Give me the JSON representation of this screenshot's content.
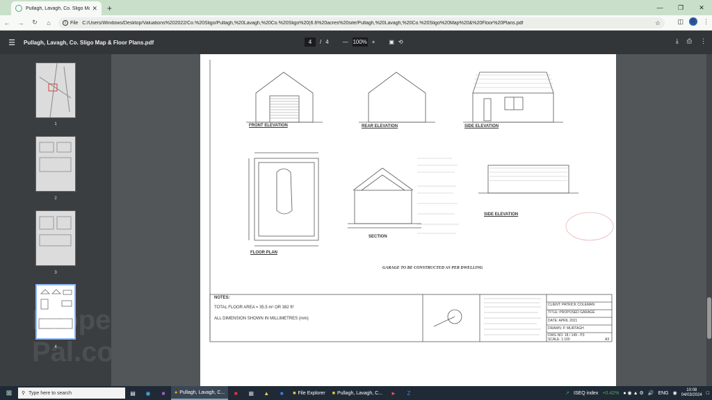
{
  "browser": {
    "tab_title": "Pullagh, Lavagh, Co. Sligo Map",
    "tab_close": "✕",
    "new_tab": "+",
    "window_controls": [
      "—",
      "❐",
      "✕"
    ],
    "address_scheme": "File",
    "address_url": "C:/Users/Windows/Desktop/Valuations%202022/Co.%20Sligo/Pullagh,%20Lavagh,%20Co.%20Sligo%20(6.6%20acres%20site/Pullagh,%20Lavagh,%20Co.%20Sligo%20Map%20&%20Floor%20Plans.pdf",
    "profile_initial": "R"
  },
  "pdf": {
    "document_title": "Pullagh, Lavagh, Co. Sligo Map & Floor Plans.pdf",
    "current_page": "4",
    "page_separator": "/",
    "total_pages": "4",
    "zoom": "100%",
    "thumbnails": [
      {
        "number": "1"
      },
      {
        "number": "2"
      },
      {
        "number": "3"
      },
      {
        "number": "4"
      }
    ],
    "selected_page": 4
  },
  "watermark": {
    "line1": "Property",
    "line2": "Pal.com"
  },
  "drawing": {
    "front_elevation": "FRONT ELEVATION",
    "rear_elevation": "REAR ELEVATION",
    "side_elevation_top": "SIDE ELEVATION",
    "side_elevation_bottom": "SIDE ELEVATION",
    "floor_plan": "FLOOR PLAN",
    "section": "SECTION",
    "caption": "GARAGE TO BE CONSTRUCTED AS PER DWELLING",
    "notes_heading": "NOTES:",
    "total_floor_area": "TOTAL FLOOR AREA = 35.5 m² OR 382 ft²",
    "dimensions_note": "ALL DIMENSION SHOWN IN MILLIMETRES (mm)",
    "title_block": [
      {
        "label": "CLIENT:",
        "value": "PATRICK COLEMAN"
      },
      {
        "label": "TITLE:",
        "value": "PROPOSED GARAGE"
      },
      {
        "label": "DATE:",
        "value": "APRIL 2021"
      },
      {
        "label": "DRAWN:",
        "value": "P. MURTAGH"
      },
      {
        "label": "DWG NO:",
        "value": "18 / 149 - P3"
      },
      {
        "label": "SCALE:",
        "value": "1:100"
      }
    ],
    "sheet_size": "A3"
  },
  "taskbar": {
    "search_placeholder": "Type here to search",
    "apps": [
      {
        "label": "Pullagh, Lavagh, C...",
        "active": true
      },
      {
        "label": "File Explorer",
        "active": false
      },
      {
        "label": "Pullagh, Lavagh, C...",
        "active": false
      }
    ],
    "stock_name": "ISEQ index",
    "stock_change": "+0.42%",
    "language": "ENG",
    "time": "10:08",
    "date": "04/03/2024"
  }
}
